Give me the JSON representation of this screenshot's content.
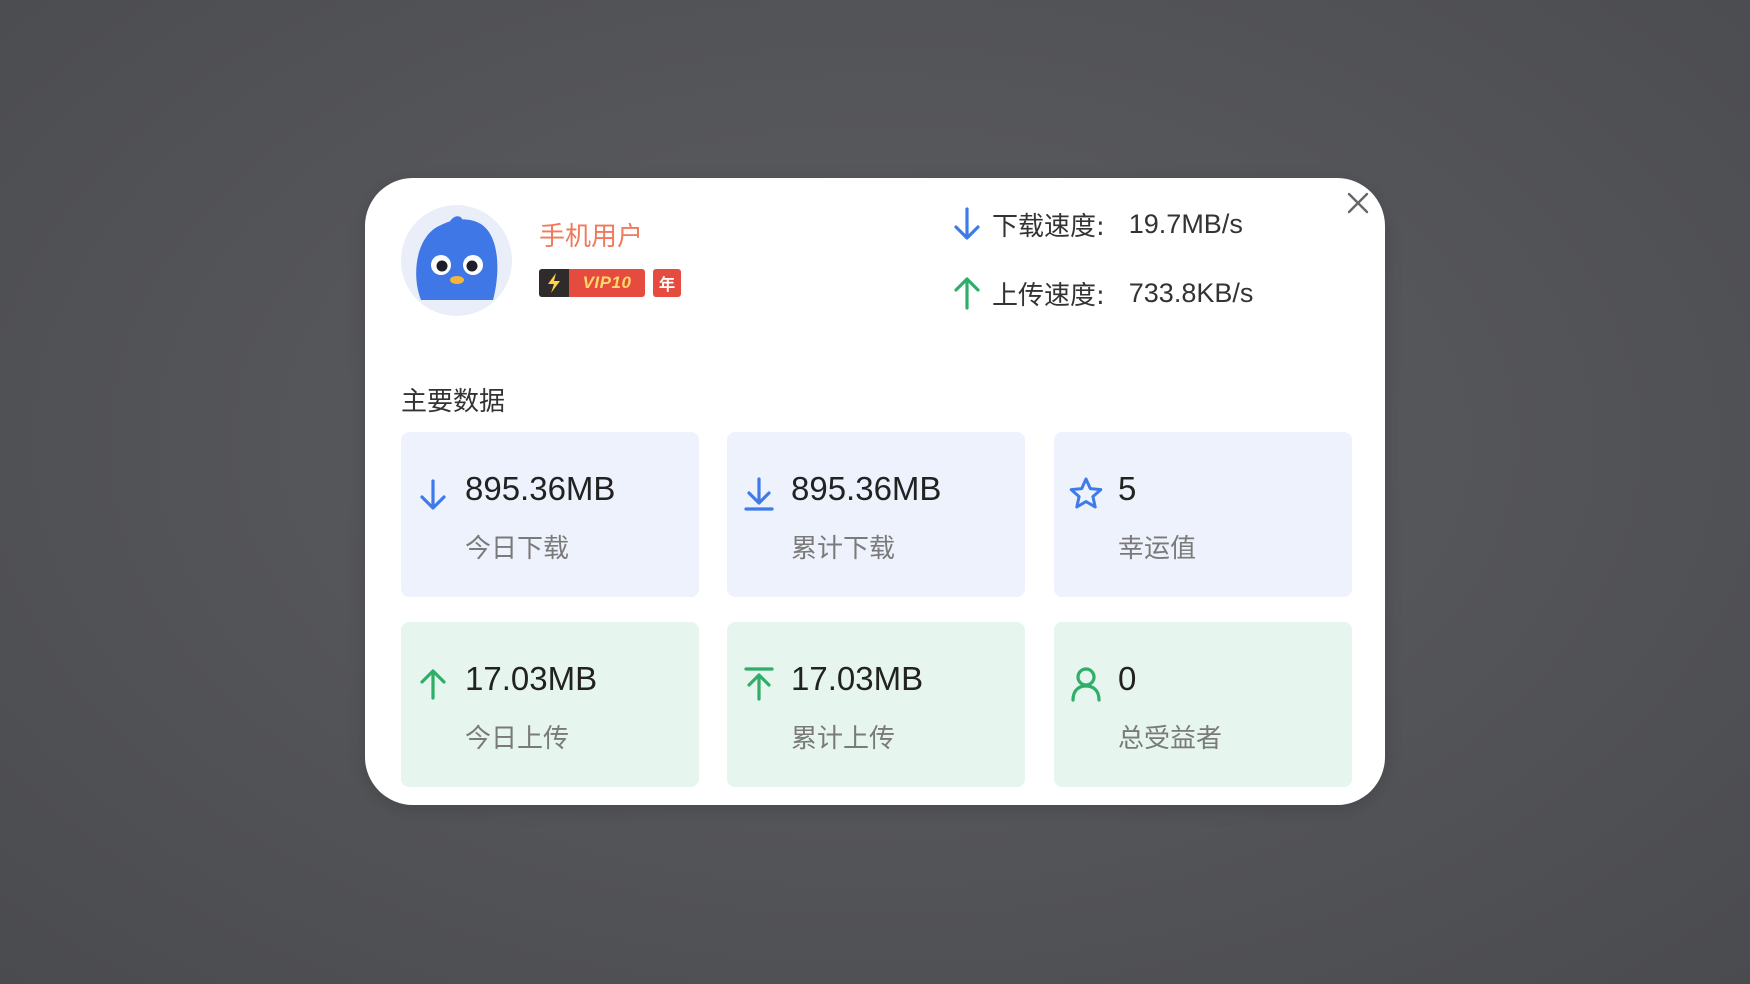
{
  "user": {
    "name": "手机用户",
    "vip_label": "VIP10",
    "year_badge": "年"
  },
  "speeds": {
    "download_label": "下载速度:",
    "download_value": "19.7MB/s",
    "upload_label": "上传速度:",
    "upload_value": "733.8KB/s"
  },
  "section_title": "主要数据",
  "stats": [
    {
      "value": "895.36MB",
      "label": "今日下载",
      "icon": "arrow-down-icon"
    },
    {
      "value": "895.36MB",
      "label": "累计下载",
      "icon": "download-to-line-icon"
    },
    {
      "value": "5",
      "label": "幸运值",
      "icon": "star-outline-icon"
    },
    {
      "value": "17.03MB",
      "label": "今日上传",
      "icon": "arrow-up-icon"
    },
    {
      "value": "17.03MB",
      "label": "累计上传",
      "icon": "upload-from-line-icon"
    },
    {
      "value": "0",
      "label": "总受益者",
      "icon": "user-outline-icon"
    }
  ],
  "colors": {
    "blue_accent": "#3f7be8",
    "green_accent": "#2fae6a",
    "username": "#f07a5b",
    "vip_red": "#e54b3f"
  }
}
